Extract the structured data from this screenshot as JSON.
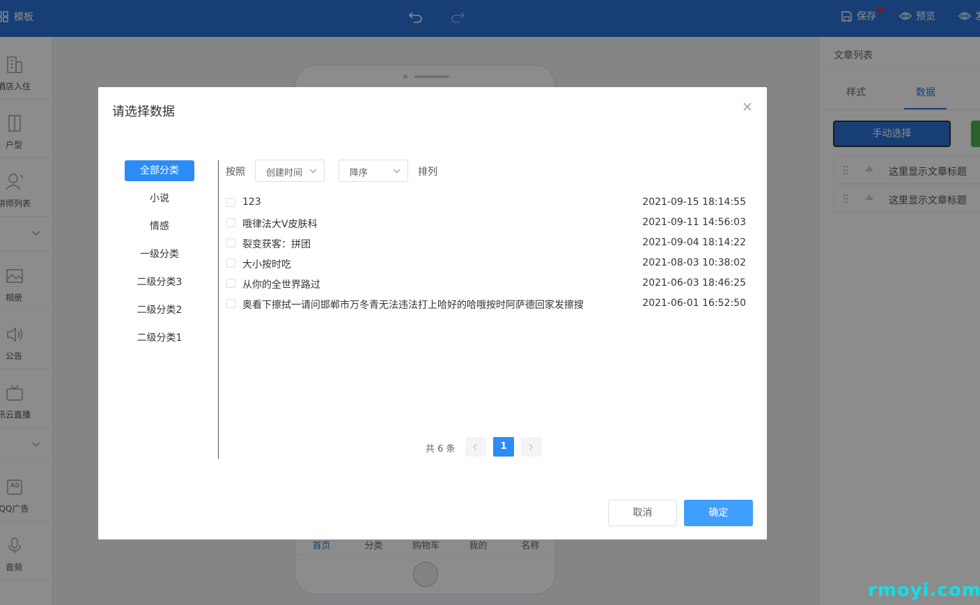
{
  "topbar": {
    "template_label": "模板",
    "save_label": "保存",
    "preview_label": "预览",
    "publish_label": "发"
  },
  "sidebar": {
    "items": [
      {
        "label": "酒店入住",
        "icon": "building-icon"
      },
      {
        "label": "户型",
        "icon": "door-icon"
      },
      {
        "label": "讲师列表",
        "icon": "user-icon"
      },
      {
        "label": "相册",
        "icon": "image-icon"
      },
      {
        "label": "公告",
        "icon": "speaker-icon"
      },
      {
        "label": "讯云直播",
        "icon": "tv-icon"
      },
      {
        "label": "QQ广告",
        "icon": "ad-icon"
      },
      {
        "label": "音频",
        "icon": "mic-icon"
      }
    ]
  },
  "phone": {
    "tabs": [
      "首页",
      "分类",
      "购物车",
      "我的",
      "名称"
    ]
  },
  "right_panel": {
    "title": "文章列表",
    "tabs": [
      "样式",
      "数据"
    ],
    "manual_button": "手动选择",
    "items": [
      "这里显示文章标题",
      "这里显示文章标题"
    ]
  },
  "modal": {
    "title": "请选择数据",
    "categories": [
      "全部分类",
      "小说",
      "情感",
      "一级分类",
      "二级分类3",
      "二级分类2",
      "二级分类1"
    ],
    "sort": {
      "prefix": "按照",
      "field": "创建时间",
      "order": "降序",
      "suffix": "排列"
    },
    "rows": [
      {
        "title": "123",
        "time": "2021-09-15 18:14:55"
      },
      {
        "title": "哦律法大V皮肤科",
        "time": "2021-09-11 14:56:03"
      },
      {
        "title": "裂变获客：拼团",
        "time": "2021-09-04 18:14:22"
      },
      {
        "title": "大小按时吃",
        "time": "2021-08-03 10:38:02"
      },
      {
        "title": "从你的全世界路过",
        "time": "2021-06-03 18:46:25"
      },
      {
        "title": "奥看下擦拭一请问邯郸市万冬青无法违法打上哈好的哈哦按时阿萨德回家发擦搜",
        "time": "2021-06-01 16:52:50"
      }
    ],
    "pagination": {
      "total": "共 6 条",
      "current": "1"
    },
    "cancel": "取消",
    "confirm": "确定"
  },
  "watermark": "rmoyi.com",
  "colors": {
    "primary": "#2b73d8",
    "accent": "#409eff"
  }
}
